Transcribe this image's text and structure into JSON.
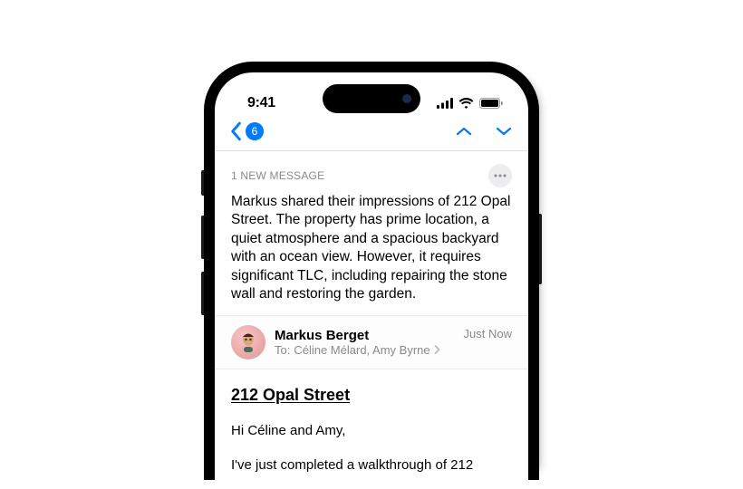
{
  "status": {
    "time": "9:41"
  },
  "nav": {
    "badge_count": "6"
  },
  "summary": {
    "label": "1 NEW MESSAGE",
    "text": "Markus shared their impressions of 212 Opal Street. The property has prime location, a quiet atmosphere and a spacious backyard with an ocean view. However, it requires significant TLC, including repairing the stone wall and restoring the garden."
  },
  "sender": {
    "name": "Markus Berget",
    "to_label": "To:",
    "recipients": "Céline Mélard, Amy Byrne",
    "timestamp": "Just Now"
  },
  "email": {
    "subject": "212 Opal Street",
    "greeting": "Hi Céline and Amy,",
    "body_partial": "I've just completed a walkthrough of 212"
  }
}
